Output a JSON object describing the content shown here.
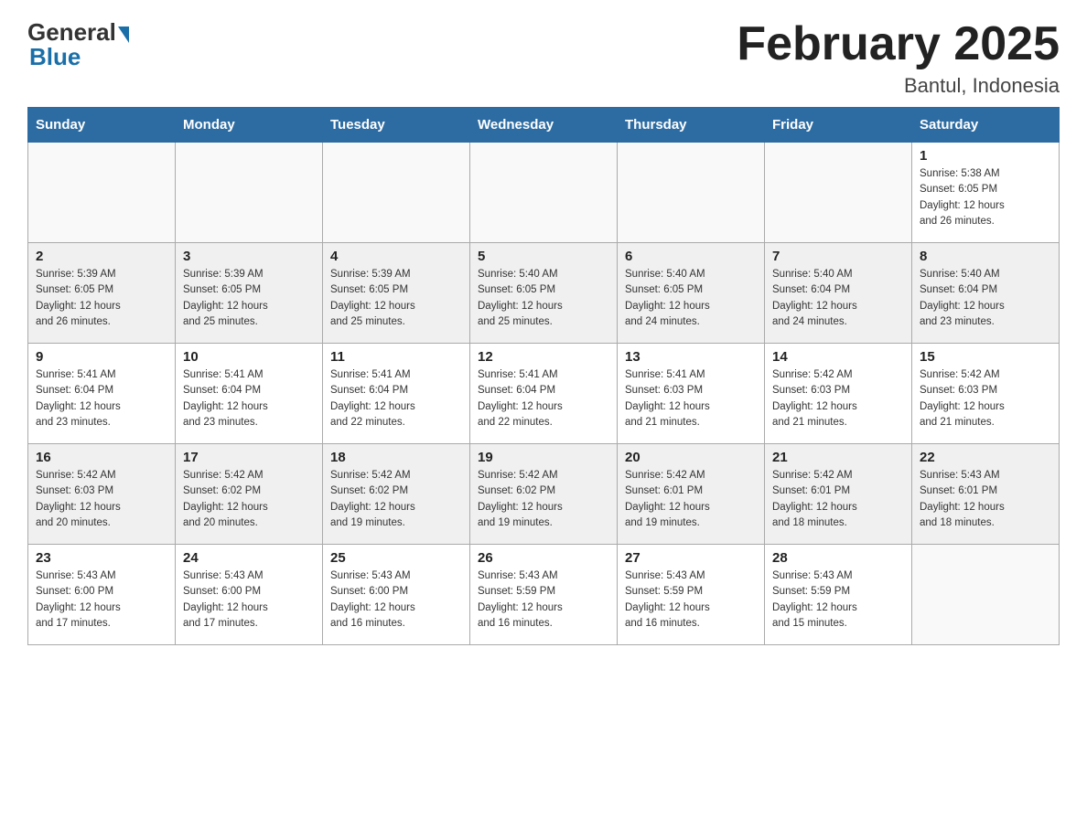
{
  "header": {
    "logo_general": "General",
    "logo_blue": "Blue",
    "title": "February 2025",
    "location": "Bantul, Indonesia"
  },
  "weekdays": [
    "Sunday",
    "Monday",
    "Tuesday",
    "Wednesday",
    "Thursday",
    "Friday",
    "Saturday"
  ],
  "weeks": [
    [
      {
        "day": "",
        "info": ""
      },
      {
        "day": "",
        "info": ""
      },
      {
        "day": "",
        "info": ""
      },
      {
        "day": "",
        "info": ""
      },
      {
        "day": "",
        "info": ""
      },
      {
        "day": "",
        "info": ""
      },
      {
        "day": "1",
        "info": "Sunrise: 5:38 AM\nSunset: 6:05 PM\nDaylight: 12 hours\nand 26 minutes."
      }
    ],
    [
      {
        "day": "2",
        "info": "Sunrise: 5:39 AM\nSunset: 6:05 PM\nDaylight: 12 hours\nand 26 minutes."
      },
      {
        "day": "3",
        "info": "Sunrise: 5:39 AM\nSunset: 6:05 PM\nDaylight: 12 hours\nand 25 minutes."
      },
      {
        "day": "4",
        "info": "Sunrise: 5:39 AM\nSunset: 6:05 PM\nDaylight: 12 hours\nand 25 minutes."
      },
      {
        "day": "5",
        "info": "Sunrise: 5:40 AM\nSunset: 6:05 PM\nDaylight: 12 hours\nand 25 minutes."
      },
      {
        "day": "6",
        "info": "Sunrise: 5:40 AM\nSunset: 6:05 PM\nDaylight: 12 hours\nand 24 minutes."
      },
      {
        "day": "7",
        "info": "Sunrise: 5:40 AM\nSunset: 6:04 PM\nDaylight: 12 hours\nand 24 minutes."
      },
      {
        "day": "8",
        "info": "Sunrise: 5:40 AM\nSunset: 6:04 PM\nDaylight: 12 hours\nand 23 minutes."
      }
    ],
    [
      {
        "day": "9",
        "info": "Sunrise: 5:41 AM\nSunset: 6:04 PM\nDaylight: 12 hours\nand 23 minutes."
      },
      {
        "day": "10",
        "info": "Sunrise: 5:41 AM\nSunset: 6:04 PM\nDaylight: 12 hours\nand 23 minutes."
      },
      {
        "day": "11",
        "info": "Sunrise: 5:41 AM\nSunset: 6:04 PM\nDaylight: 12 hours\nand 22 minutes."
      },
      {
        "day": "12",
        "info": "Sunrise: 5:41 AM\nSunset: 6:04 PM\nDaylight: 12 hours\nand 22 minutes."
      },
      {
        "day": "13",
        "info": "Sunrise: 5:41 AM\nSunset: 6:03 PM\nDaylight: 12 hours\nand 21 minutes."
      },
      {
        "day": "14",
        "info": "Sunrise: 5:42 AM\nSunset: 6:03 PM\nDaylight: 12 hours\nand 21 minutes."
      },
      {
        "day": "15",
        "info": "Sunrise: 5:42 AM\nSunset: 6:03 PM\nDaylight: 12 hours\nand 21 minutes."
      }
    ],
    [
      {
        "day": "16",
        "info": "Sunrise: 5:42 AM\nSunset: 6:03 PM\nDaylight: 12 hours\nand 20 minutes."
      },
      {
        "day": "17",
        "info": "Sunrise: 5:42 AM\nSunset: 6:02 PM\nDaylight: 12 hours\nand 20 minutes."
      },
      {
        "day": "18",
        "info": "Sunrise: 5:42 AM\nSunset: 6:02 PM\nDaylight: 12 hours\nand 19 minutes."
      },
      {
        "day": "19",
        "info": "Sunrise: 5:42 AM\nSunset: 6:02 PM\nDaylight: 12 hours\nand 19 minutes."
      },
      {
        "day": "20",
        "info": "Sunrise: 5:42 AM\nSunset: 6:01 PM\nDaylight: 12 hours\nand 19 minutes."
      },
      {
        "day": "21",
        "info": "Sunrise: 5:42 AM\nSunset: 6:01 PM\nDaylight: 12 hours\nand 18 minutes."
      },
      {
        "day": "22",
        "info": "Sunrise: 5:43 AM\nSunset: 6:01 PM\nDaylight: 12 hours\nand 18 minutes."
      }
    ],
    [
      {
        "day": "23",
        "info": "Sunrise: 5:43 AM\nSunset: 6:00 PM\nDaylight: 12 hours\nand 17 minutes."
      },
      {
        "day": "24",
        "info": "Sunrise: 5:43 AM\nSunset: 6:00 PM\nDaylight: 12 hours\nand 17 minutes."
      },
      {
        "day": "25",
        "info": "Sunrise: 5:43 AM\nSunset: 6:00 PM\nDaylight: 12 hours\nand 16 minutes."
      },
      {
        "day": "26",
        "info": "Sunrise: 5:43 AM\nSunset: 5:59 PM\nDaylight: 12 hours\nand 16 minutes."
      },
      {
        "day": "27",
        "info": "Sunrise: 5:43 AM\nSunset: 5:59 PM\nDaylight: 12 hours\nand 16 minutes."
      },
      {
        "day": "28",
        "info": "Sunrise: 5:43 AM\nSunset: 5:59 PM\nDaylight: 12 hours\nand 15 minutes."
      },
      {
        "day": "",
        "info": ""
      }
    ]
  ]
}
